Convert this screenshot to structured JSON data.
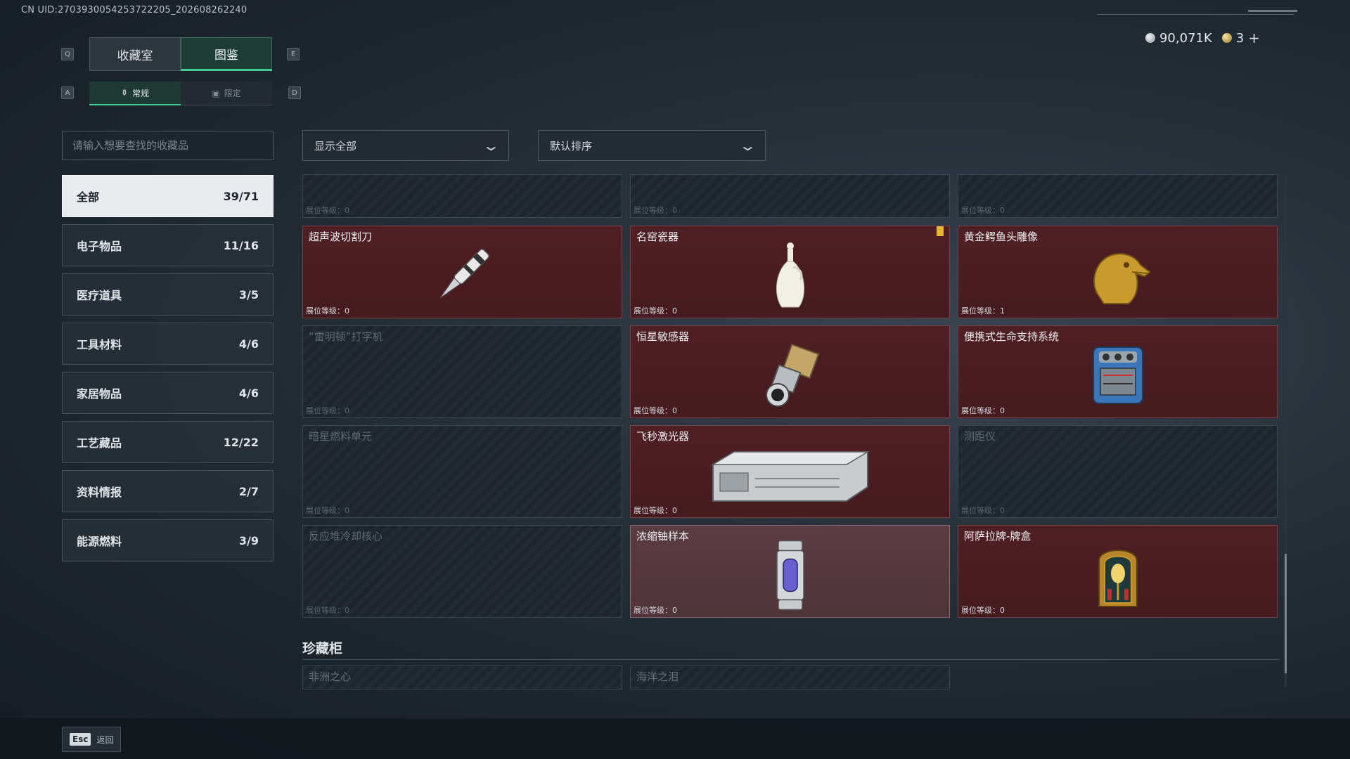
{
  "uid": "CN UID:27039300542537222​05_202608262240",
  "currency": {
    "coins": "90,071K",
    "tokens": "3",
    "plus": "+"
  },
  "keys": {
    "q": "Q",
    "e": "E",
    "a": "A",
    "d": "D"
  },
  "tabs": [
    {
      "label": "收藏室"
    },
    {
      "label": "图鉴"
    }
  ],
  "subtabs": [
    {
      "label": "常规"
    },
    {
      "label": "限定"
    }
  ],
  "search": {
    "placeholder": "请输入想要查找的收藏品"
  },
  "categories": [
    {
      "label": "全部",
      "count": "39/71"
    },
    {
      "label": "电子物品",
      "count": "11/16"
    },
    {
      "label": "医疗道具",
      "count": "3/5"
    },
    {
      "label": "工具材料",
      "count": "4/6"
    },
    {
      "label": "家居物品",
      "count": "4/6"
    },
    {
      "label": "工艺藏品",
      "count": "12/22"
    },
    {
      "label": "资料情报",
      "count": "2/7"
    },
    {
      "label": "能源燃料",
      "count": "3/9"
    }
  ],
  "filters": {
    "show": "显示全部",
    "sort": "默认排序"
  },
  "level_prefix": "展位等级：",
  "items": [
    {
      "name": "",
      "level": "展位等级：0"
    },
    {
      "name": "",
      "level": "展位等级：0"
    },
    {
      "name": "",
      "level": "展位等级：0"
    },
    {
      "name": "超声波切割刀",
      "level": "展位等级：0"
    },
    {
      "name": "名窑瓷器",
      "level": "展位等级：0"
    },
    {
      "name": "黄金鳄鱼头雕像",
      "level": "展位等级：1"
    },
    {
      "name": "“雷明顿”打字机",
      "level": "展位等级：0"
    },
    {
      "name": "恒星敏感器",
      "level": "展位等级：0"
    },
    {
      "name": "便携式生命支持系统",
      "level": "展位等级：0"
    },
    {
      "name": "暗星燃料单元",
      "level": "展位等级：0"
    },
    {
      "name": "飞秒激光器",
      "level": "展位等级：0"
    },
    {
      "name": "测距仪",
      "level": "展位等级：0"
    },
    {
      "name": "反应堆冷却核心",
      "level": "展位等级：0"
    },
    {
      "name": "浓缩铀样本",
      "level": "展位等级：0"
    },
    {
      "name": "阿萨拉牌-牌盒",
      "level": "展位等级：0"
    }
  ],
  "cabinet": {
    "title": "珍藏柜",
    "items": [
      {
        "name": "非洲之心"
      },
      {
        "name": "海洋之泪"
      }
    ]
  },
  "footer": {
    "esc_key": "Esc",
    "back": "返回"
  }
}
